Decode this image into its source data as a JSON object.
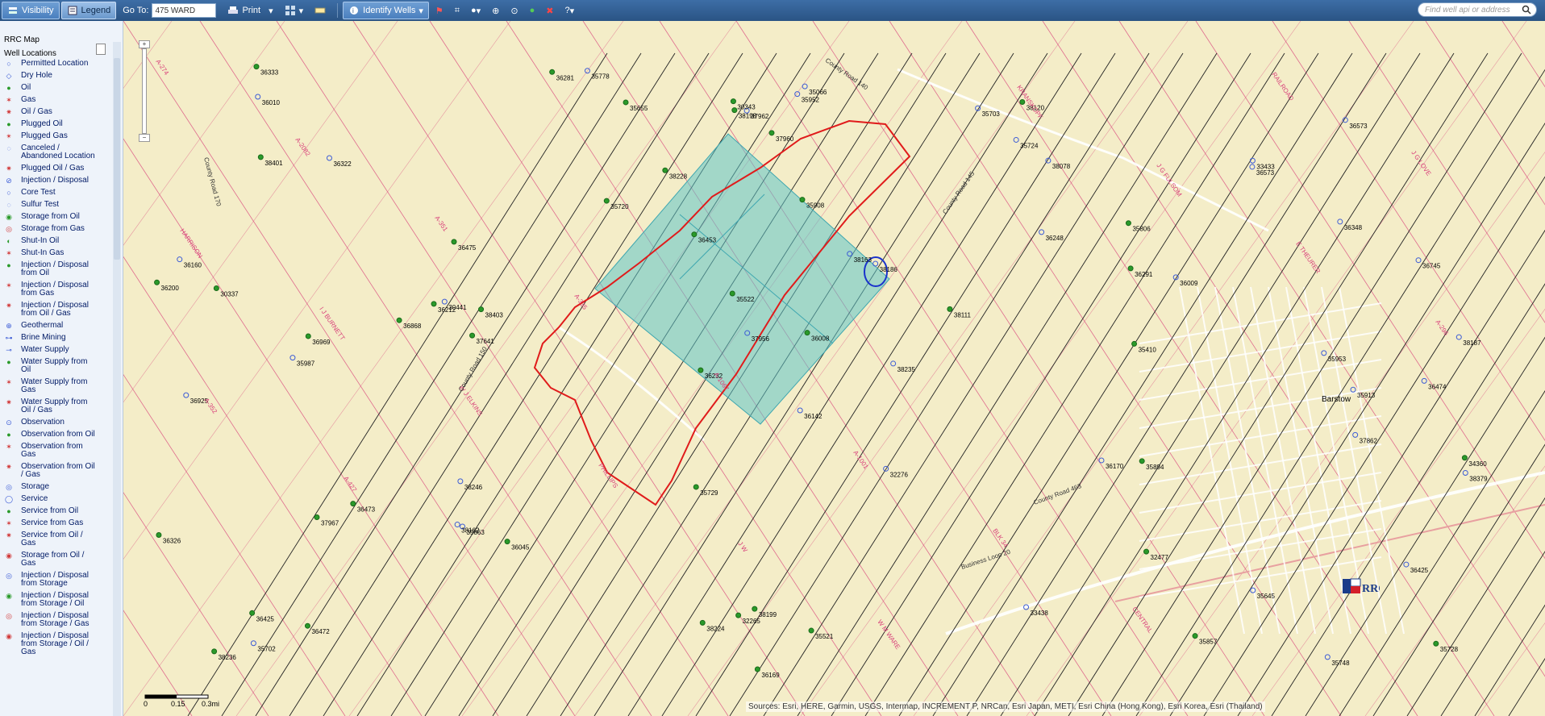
{
  "toolbar": {
    "visibility_label": "Visibility",
    "legend_label": "Legend",
    "goto_label": "Go To:",
    "goto_value": "475 WARD",
    "print_label": "Print",
    "identify_label": "Identify Wells",
    "search_placeholder": "Find well api or address",
    "colors": {
      "bar": "#2a5484",
      "active": "#9cc0e8"
    }
  },
  "panel": {
    "title": "RRC Map",
    "section": "Well Locations",
    "items": [
      {
        "label": "Permitted Location",
        "icon": "circle-open-icon",
        "color": "#3b5bd6"
      },
      {
        "label": "Dry Hole",
        "icon": "dry-hole-icon",
        "color": "#3b5bd6"
      },
      {
        "label": "Oil",
        "icon": "oil-dot-icon",
        "color": "#2a9a2a"
      },
      {
        "label": "Gas",
        "icon": "gas-star-icon",
        "color": "#d23b3b"
      },
      {
        "label": "Oil / Gas",
        "icon": "oil-gas-icon",
        "color": "#d23b3b"
      },
      {
        "label": "Plugged Oil",
        "icon": "plugged-oil-icon",
        "color": "#2a9a2a"
      },
      {
        "label": "Plugged Gas",
        "icon": "plugged-gas-icon",
        "color": "#d23b3b"
      },
      {
        "label": "Canceled / Abandoned Location",
        "icon": "canceled-icon",
        "color": "#3b5bd6"
      },
      {
        "label": "Plugged Oil / Gas",
        "icon": "plugged-oil-gas-icon",
        "color": "#d23b3b"
      },
      {
        "label": "Injection / Disposal",
        "icon": "injection-icon",
        "color": "#3b5bd6"
      },
      {
        "label": "Core Test",
        "icon": "core-test-icon",
        "color": "#3b5bd6"
      },
      {
        "label": "Sulfur Test",
        "icon": "sulfur-test-icon",
        "color": "#3b5bd6"
      },
      {
        "label": "Storage from Oil",
        "icon": "storage-oil-icon",
        "color": "#2a9a2a"
      },
      {
        "label": "Storage from Gas",
        "icon": "storage-gas-icon",
        "color": "#d23b3b"
      },
      {
        "label": "Shut-In Oil",
        "icon": "shut-in-oil-icon",
        "color": "#2a9a2a"
      },
      {
        "label": "Shut-In Gas",
        "icon": "shut-in-gas-icon",
        "color": "#d23b3b"
      },
      {
        "label": "Injection / Disposal from Oil",
        "icon": "inj-oil-icon",
        "color": "#2a9a2a"
      },
      {
        "label": "Injection / Disposal from Gas",
        "icon": "inj-gas-icon",
        "color": "#d23b3b"
      },
      {
        "label": "Injection / Disposal from Oil / Gas",
        "icon": "inj-oil-gas-icon",
        "color": "#d23b3b"
      },
      {
        "label": "Geothermal",
        "icon": "geothermal-icon",
        "color": "#3b5bd6"
      },
      {
        "label": "Brine Mining",
        "icon": "brine-icon",
        "color": "#3b5bd6"
      },
      {
        "label": "Water Supply",
        "icon": "water-supply-icon",
        "color": "#3b5bd6"
      },
      {
        "label": "Water Supply from Oil",
        "icon": "water-oil-icon",
        "color": "#2a9a2a"
      },
      {
        "label": "Water Supply from Gas",
        "icon": "water-gas-icon",
        "color": "#d23b3b"
      },
      {
        "label": "Water Supply from Oil / Gas",
        "icon": "water-oil-gas-icon",
        "color": "#d23b3b"
      },
      {
        "label": "Observation",
        "icon": "observation-icon",
        "color": "#3b5bd6"
      },
      {
        "label": "Observation from Oil",
        "icon": "obs-oil-icon",
        "color": "#2a9a2a"
      },
      {
        "label": "Observation from Gas",
        "icon": "obs-gas-icon",
        "color": "#d23b3b"
      },
      {
        "label": "Observation from Oil / Gas",
        "icon": "obs-oil-gas-icon",
        "color": "#d23b3b"
      },
      {
        "label": "Storage",
        "icon": "storage-icon",
        "color": "#3b5bd6"
      },
      {
        "label": "Service",
        "icon": "service-icon",
        "color": "#3b5bd6"
      },
      {
        "label": "Service from Oil",
        "icon": "service-oil-icon",
        "color": "#2a9a2a"
      },
      {
        "label": "Service from Gas",
        "icon": "service-gas-icon",
        "color": "#d23b3b"
      },
      {
        "label": "Service from Oil / Gas",
        "icon": "service-oil-gas-icon",
        "color": "#d23b3b"
      },
      {
        "label": "Storage from Oil / Gas",
        "icon": "storage-oil-gas-icon",
        "color": "#d23b3b"
      },
      {
        "label": "Injection / Disposal from Storage",
        "icon": "inj-storage-icon",
        "color": "#3b5bd6"
      },
      {
        "label": "Injection / Disposal from Storage / Oil",
        "icon": "inj-storage-oil-icon",
        "color": "#2a9a2a"
      },
      {
        "label": "Injection / Disposal from Storage / Gas",
        "icon": "inj-storage-gas-icon",
        "color": "#d23b3b"
      },
      {
        "label": "Injection / Disposal from Storage / Oil / Gas",
        "icon": "inj-storage-oil-gas-icon",
        "color": "#d23b3b"
      }
    ]
  },
  "map": {
    "colors": {
      "base": "#f4edc8",
      "survey": "#d8407a",
      "highlight": "#5fc4c8",
      "outline_red": "#e01b1b",
      "outline_blue": "#1a33cc",
      "wellbore": "#222222"
    },
    "city_label": "Barstow",
    "roads": [
      "County Road 140",
      "County Road 145",
      "County Road 170",
      "County Road 150",
      "County Road 463",
      "Business Loop 20"
    ],
    "surveys": [
      "A-274",
      "A-2082",
      "A-351",
      "A-335",
      "A-1067",
      "A-1001",
      "BLK 34",
      "CENTRAL",
      "RAILROAD",
      "J G LOVE",
      "HARRISON",
      "I J BURNETT",
      "W J ELKINS",
      "PHILLIPS",
      "J W",
      "W M WARE",
      "KRANSKOPF",
      "J G FULSOM",
      "E THEURER",
      "A-296",
      "A-352",
      "A-427"
    ],
    "well_numbers": [
      "36142",
      "37641",
      "36425",
      "36453",
      "38120",
      "38246",
      "38235",
      "38236",
      "36969",
      "36868",
      "36248",
      "38187",
      "38186",
      "36009",
      "35702",
      "35953",
      "38111",
      "35724",
      "37962",
      "35729",
      "36745",
      "36008",
      "37956",
      "35863",
      "36045",
      "35728",
      "35894",
      "36160",
      "36212",
      "35806",
      "36200",
      "38198",
      "38199",
      "37960",
      "36348",
      "36473",
      "33438",
      "33433",
      "36333",
      "35645",
      "35066",
      "35952",
      "36475",
      "36322",
      "35703",
      "35987",
      "36326",
      "36291",
      "36170",
      "35655",
      "36010",
      "36281",
      "35522",
      "35913",
      "36472",
      "35521",
      "36169",
      "36232",
      "35857",
      "34360",
      "30343",
      "32276",
      "32477",
      "32265",
      "30337",
      "38379",
      "38078",
      "38163",
      "36474",
      "38228",
      "38162",
      "37862",
      "36573",
      "38224",
      "38401",
      "38403",
      "35778",
      "35410",
      "36573",
      "30441",
      "37967",
      "36925",
      "35720",
      "35908",
      "35748",
      "36425"
    ],
    "attribution": "Sources: Esri, HERE, Garmin, USGS, Intermap, INCREMENT P, NRCan, Esri Japan, METI, Esri China (Hong Kong), Esri Korea, Esri (Thailand)",
    "scale_labels": [
      "0",
      "0.15",
      "0.3mi"
    ],
    "zoom_plus": "+",
    "zoom_minus": "−"
  }
}
